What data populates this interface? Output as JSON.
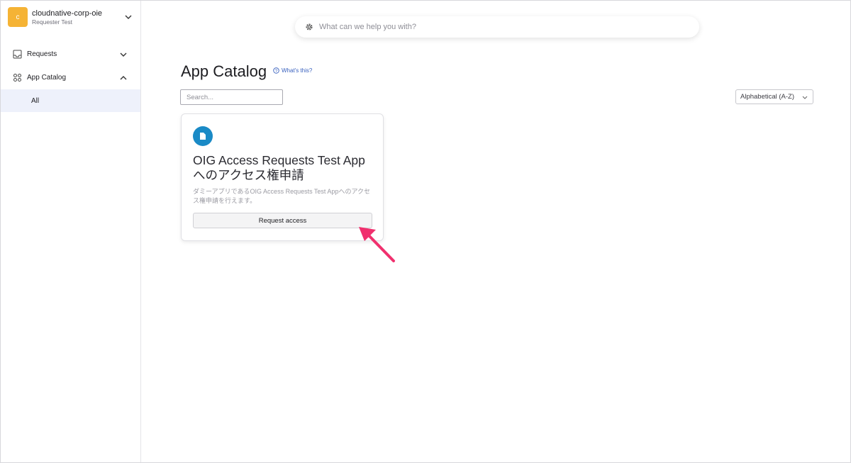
{
  "org": {
    "initial": "c",
    "name": "cloudnative-corp-oie",
    "subtitle": "Requester Test"
  },
  "sidebar": {
    "items": [
      {
        "label": "Requests",
        "icon": "inbox-icon"
      },
      {
        "label": "App Catalog",
        "icon": "grid-icon"
      }
    ],
    "sub_items": [
      {
        "label": "All"
      }
    ]
  },
  "header": {
    "search_placeholder": "What can we help you with?"
  },
  "main": {
    "title": "App Catalog",
    "help_link": "What's this?",
    "search_placeholder": "Search...",
    "sort": "Alphabetical (A-Z)",
    "apps": [
      {
        "title_line1": "OIG Access Requests Test App",
        "title_line2": "へのアクセス権申請",
        "description": "ダミーアプリであるOIG Access Requests Test Appへのアクセス権申請を行えます。",
        "button": "Request access"
      }
    ]
  },
  "colors": {
    "accent": "#1a8ac6",
    "org_logo": "#f5b335",
    "annotation": "#f0306e"
  }
}
